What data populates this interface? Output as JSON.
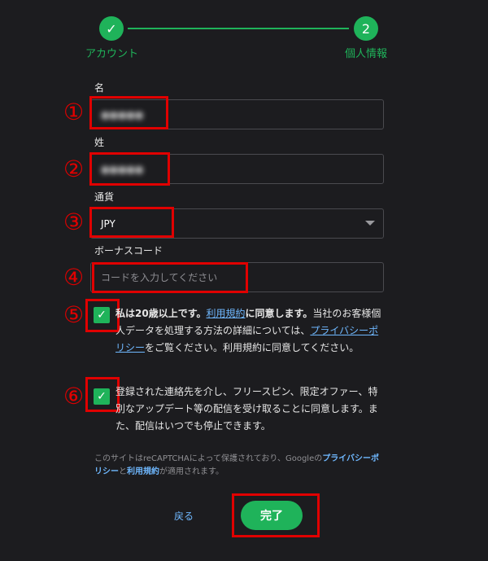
{
  "stepper": {
    "step1_label": "アカウント",
    "step1_icon": "check-icon",
    "step2_number": "2",
    "step2_label": "個人情報",
    "accent": "#1fb35a"
  },
  "annotations": {
    "n1": "①",
    "n2": "②",
    "n3": "③",
    "n4": "④",
    "n5": "⑤",
    "n6": "⑥",
    "highlight_color": "#e00000"
  },
  "form": {
    "first_name": {
      "label": "名",
      "value": "●●●●●"
    },
    "last_name": {
      "label": "姓",
      "value": "●●●●●"
    },
    "currency": {
      "label": "通貨",
      "value": "JPY"
    },
    "bonus_code": {
      "label": "ボーナスコード",
      "placeholder": "コードを入力してください"
    }
  },
  "consent1": {
    "bold_prefix": "私は20歳以上です。",
    "link1": "利用規約",
    "mid_bold": "に同意します。",
    "mid": "当社のお客様個人データを処理する方法の詳細については、",
    "link2": "プライバシーポリシー",
    "suffix": "をご覧ください。利用規約に同意してください。"
  },
  "consent2": {
    "text": "登録された連絡先を介し、フリースピン、限定オファー、特別なアップデート等の配信を受け取ることに同意します。また、配信はいつでも停止できます。"
  },
  "recaptcha": {
    "prefix": "このサイトはreCAPTCHAによって保護されており、Googleの",
    "link1": "プライバシーポリシー",
    "mid": "と",
    "link2": "利用規約",
    "suffix": "が適用されます。"
  },
  "actions": {
    "back_label": "戻る",
    "done_label": "完了"
  }
}
